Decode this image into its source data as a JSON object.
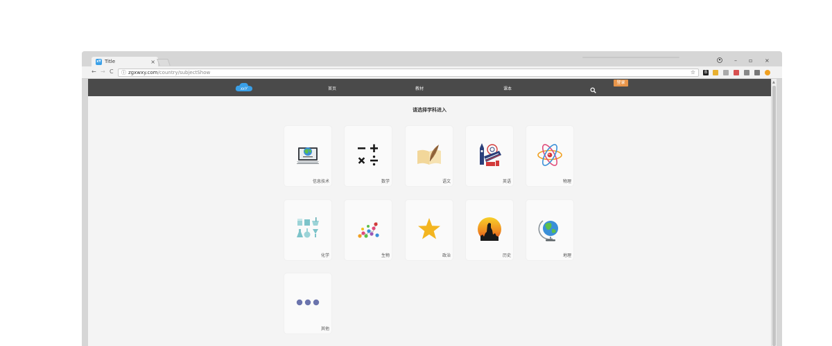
{
  "browser": {
    "tab_title": "Title",
    "tab_close": "×",
    "url_host": "zgxwxy.com",
    "url_path": "/country/subjectShow",
    "window_controls": {
      "minimize": "–",
      "maximize": "▫",
      "close": "×"
    },
    "nav_back": "←",
    "nav_forward": "→",
    "nav_reload": "C"
  },
  "site": {
    "logo_text": "xxY",
    "nav": {
      "home": "首页",
      "textbook": "教材",
      "lesson": "课本"
    },
    "login": "登录",
    "heading": "请选择学科进入"
  },
  "subjects": [
    {
      "label": "信息技术",
      "icon": "computer-globe-icon"
    },
    {
      "label": "数学",
      "icon": "math-operators-icon"
    },
    {
      "label": "语文",
      "icon": "book-quill-icon"
    },
    {
      "label": "英语",
      "icon": "london-landmarks-icon"
    },
    {
      "label": "物理",
      "icon": "atom-icon"
    },
    {
      "label": "化学",
      "icon": "lab-flasks-icon"
    },
    {
      "label": "生物",
      "icon": "dna-molecule-icon"
    },
    {
      "label": "政治",
      "icon": "star-icon"
    },
    {
      "label": "历史",
      "icon": "sunset-statue-icon"
    },
    {
      "label": "地理",
      "icon": "globe-icon"
    },
    {
      "label": "其他",
      "icon": "more-dots-icon"
    }
  ],
  "colors": {
    "nav_bg": "#4a4a4a",
    "login_bg": "#e8954a",
    "page_bg": "#f4f4f4",
    "logo": "#3aa0e8"
  }
}
